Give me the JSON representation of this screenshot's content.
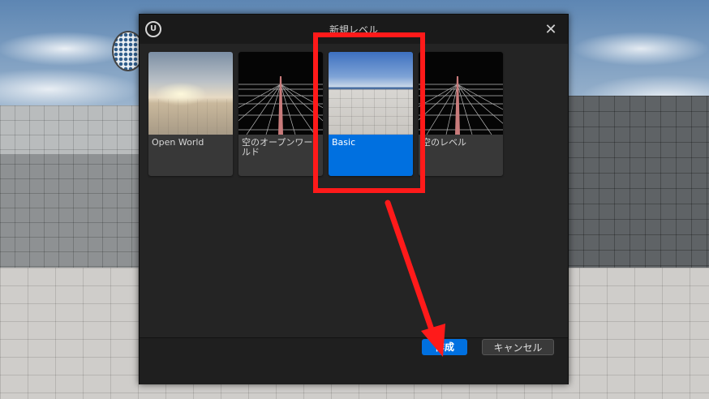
{
  "dialog": {
    "title": "新規レベル",
    "logo_text": "U",
    "close_glyph": "✕"
  },
  "templates": [
    {
      "label": "Open World",
      "selected": false,
      "thumbnail": "open-world-landscape"
    },
    {
      "label": "空のオープンワールド",
      "selected": false,
      "thumbnail": "grid-horizon"
    },
    {
      "label": "Basic",
      "selected": true,
      "thumbnail": "basic-sky-floor"
    },
    {
      "label": "空のレベル",
      "selected": false,
      "thumbnail": "grid-horizon"
    }
  ],
  "buttons": {
    "create": "作成",
    "cancel": "キャンセル"
  },
  "colors": {
    "accent": "#0070e0",
    "highlight": "#ff1a1a",
    "dialog_bg": "#242424"
  }
}
